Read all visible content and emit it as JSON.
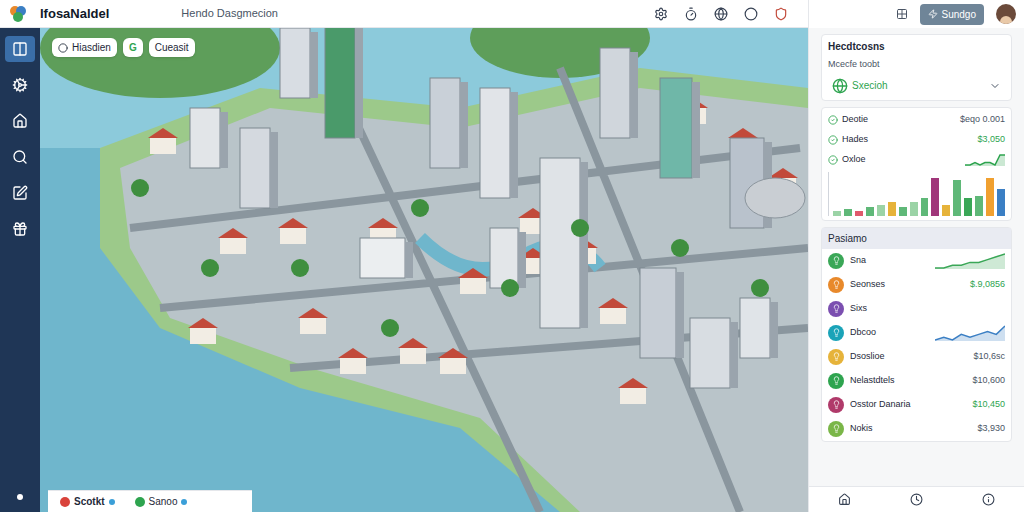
{
  "app": {
    "title": "IfosaNaldel",
    "subtitle": "Hendo Dasgmecion"
  },
  "topbar": {
    "button": "Sundgo"
  },
  "sidebar": {
    "items": [
      {
        "selected": true
      },
      {
        "selected": false
      },
      {
        "selected": false
      },
      {
        "selected": false
      },
      {
        "selected": false
      },
      {
        "selected": false
      }
    ]
  },
  "map": {
    "chips_top": [
      {
        "label": "Hiasdien"
      },
      {
        "label": "G"
      },
      {
        "label": "Cueasit"
      }
    ],
    "tabs_bottom": [
      {
        "label": "Scotkt",
        "color": "#d9433b",
        "selected": true
      },
      {
        "label": "Sanoo",
        "color": "#2ea44f",
        "selected": false
      }
    ]
  },
  "panel": {
    "title": "Hecdtcosns",
    "selector_label": "Mcecfe toobt",
    "selector_value": "Sxecioh",
    "card_rows": [
      {
        "label": "Deotie",
        "kind": "value",
        "value": "$eqo 0.001",
        "positive": false,
        "color": "#2ea44f"
      },
      {
        "label": "Hades",
        "kind": "value",
        "value": "$3,050",
        "positive": true,
        "color": "#2ea44f"
      },
      {
        "label": "Oxloe",
        "kind": "sparkline",
        "trend": [
          2,
          2,
          3,
          2,
          3,
          3,
          2,
          6,
          6
        ],
        "color": "#2ea44f"
      }
    ],
    "chart": {
      "bars": [
        {
          "value": 1,
          "color": "#9bd3a6"
        },
        {
          "value": 1.5,
          "color": "#5fb878"
        },
        {
          "value": 1,
          "color": "#e05a6d"
        },
        {
          "value": 2,
          "color": "#5fb878"
        },
        {
          "value": 2.5,
          "color": "#9bd3a6"
        },
        {
          "value": 3,
          "color": "#e6b33a"
        },
        {
          "value": 2,
          "color": "#5fb878"
        },
        {
          "value": 3,
          "color": "#9bd3a6"
        },
        {
          "value": 4,
          "color": "#5fb878"
        },
        {
          "value": 8.5,
          "color": "#a0367a"
        },
        {
          "value": 2.5,
          "color": "#e6b33a"
        },
        {
          "value": 8,
          "color": "#5fb878"
        },
        {
          "value": 4,
          "color": "#3aa757"
        },
        {
          "value": 4.5,
          "color": "#5fb878"
        },
        {
          "value": 8.5,
          "color": "#f0a030"
        },
        {
          "value": 6,
          "color": "#3b7fc4"
        }
      ]
    },
    "section_title": "Pasiamo",
    "rows": [
      {
        "label": "Sna",
        "kind": "sparkline",
        "color": "#3aa757",
        "trend": [
          1,
          1,
          2,
          2,
          3,
          3,
          4,
          5,
          6
        ],
        "line_color": "#3aa757"
      },
      {
        "label": "Seonses",
        "kind": "value",
        "color": "#e8892b",
        "value": "$.9,0856",
        "positive": true
      },
      {
        "label": "Sixs",
        "kind": "plain",
        "color": "#7b4fb0"
      },
      {
        "label": "Dbcoo",
        "kind": "sparkline",
        "color": "#1aa3b8",
        "trend": [
          1,
          2,
          1,
          3,
          2,
          3,
          4,
          3,
          6
        ],
        "line_color": "#3b7fc4"
      },
      {
        "label": "Dsoslioe",
        "kind": "value",
        "color": "#e6b33a",
        "value": "$10,6sc",
        "positive": false
      },
      {
        "label": "Nelastdtels",
        "kind": "value",
        "color": "#2ea44f",
        "value": "$10,600",
        "positive": false
      },
      {
        "label": "Osstor Danaria",
        "kind": "value",
        "color": "#b03a6a",
        "value": "$10,450",
        "positive": true
      },
      {
        "label": "Nokis",
        "kind": "value",
        "color": "#7ab648",
        "value": "$3,930",
        "positive": false
      }
    ]
  }
}
